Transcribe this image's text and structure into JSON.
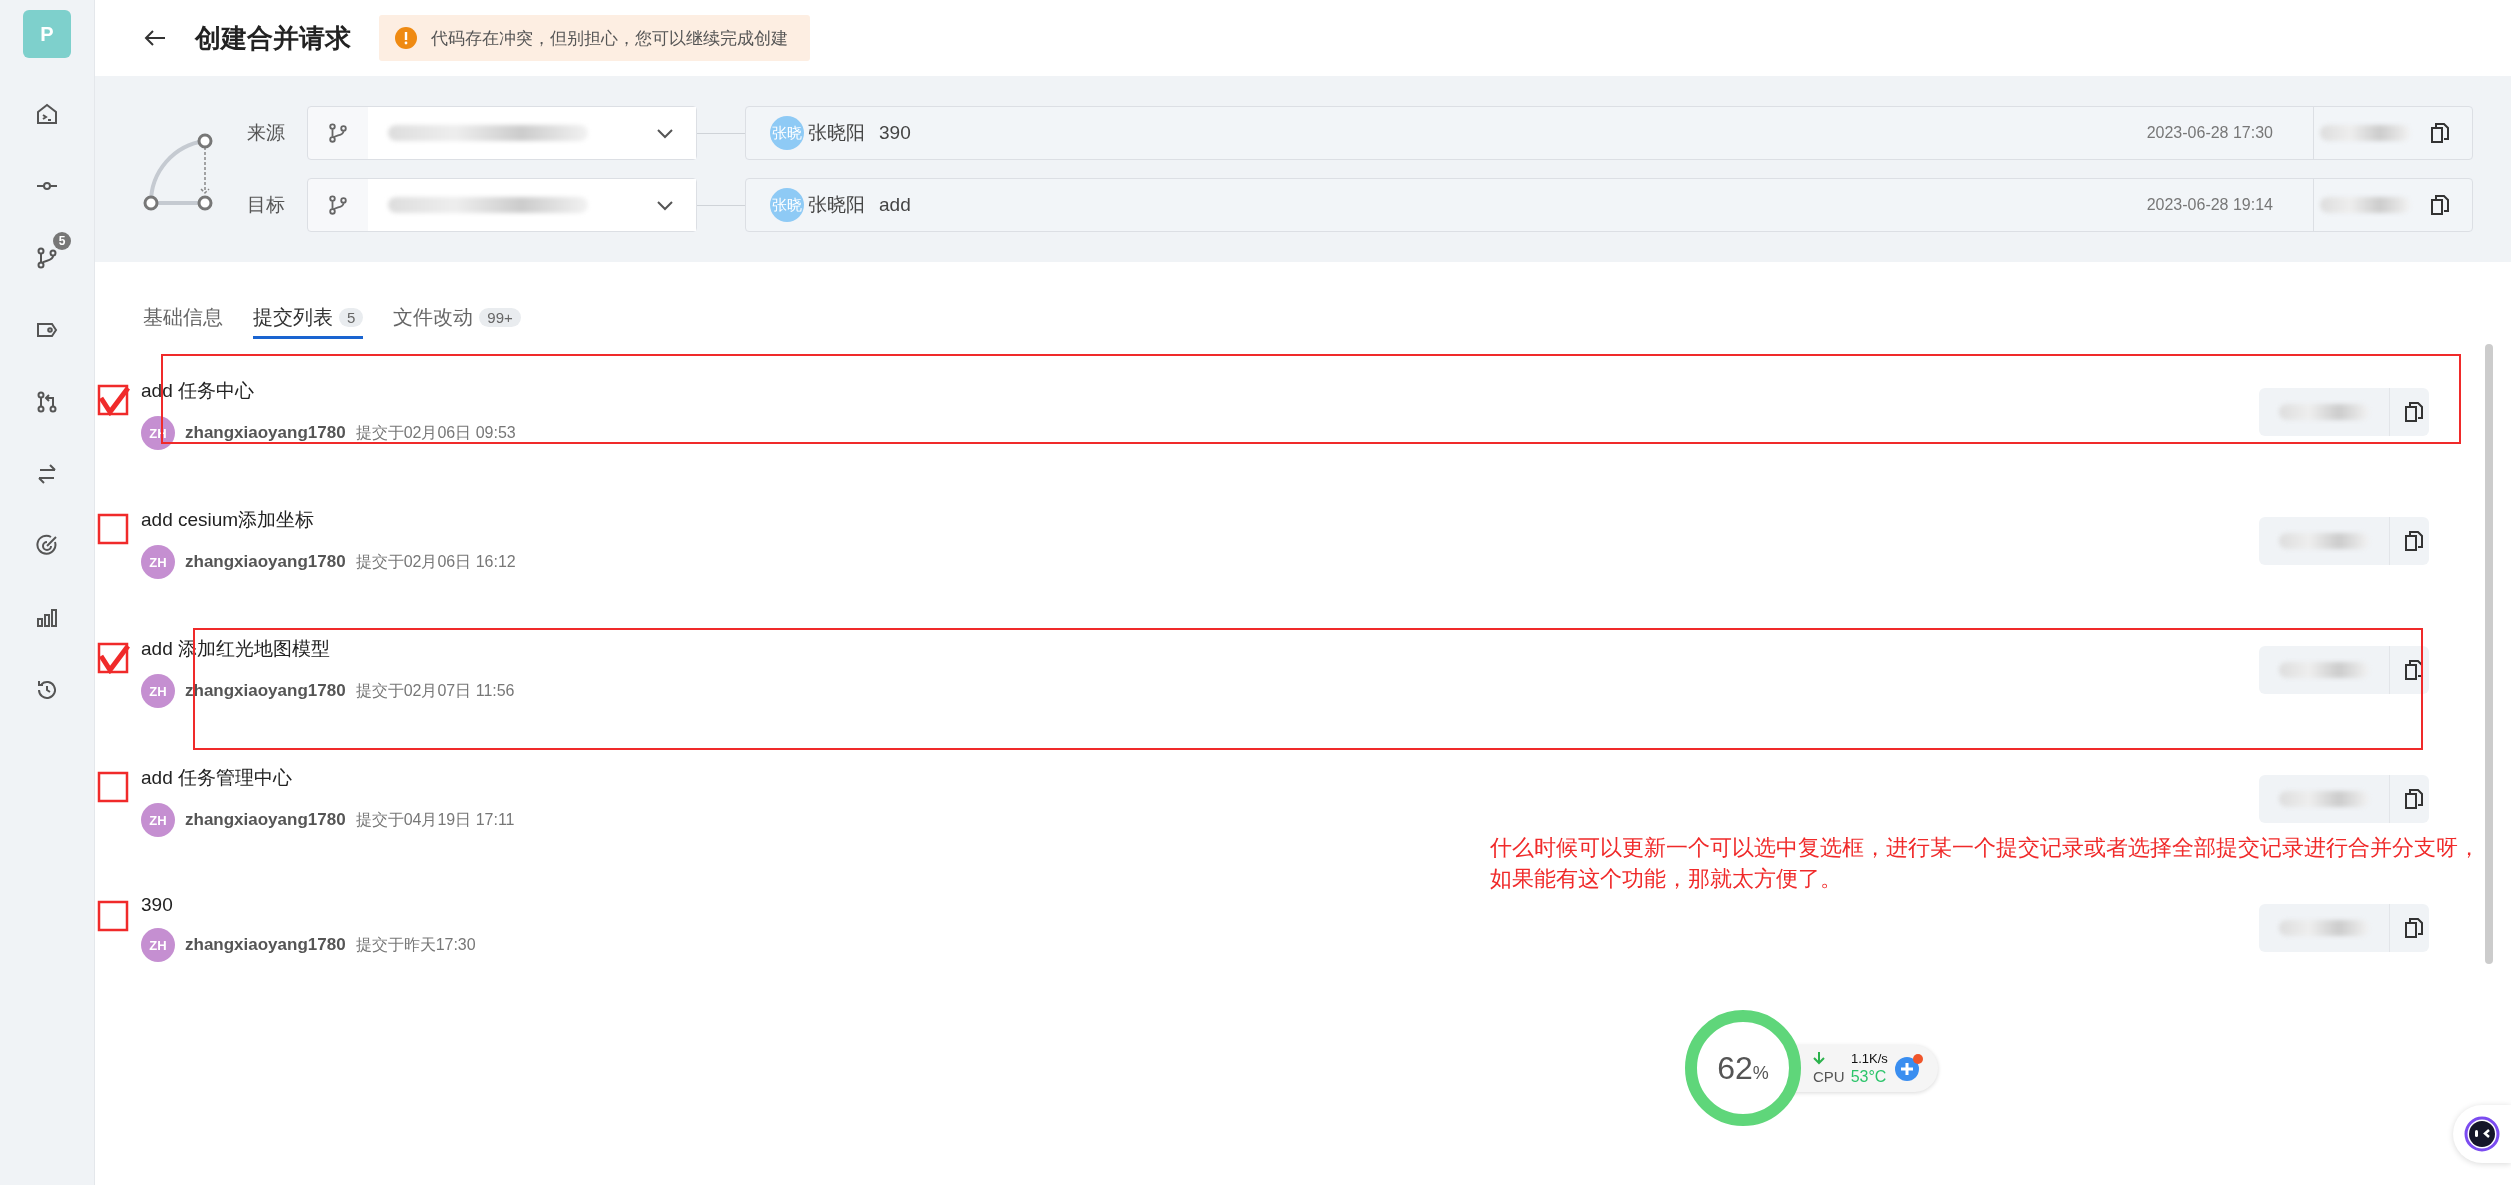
{
  "sidebar": {
    "project_initial": "P",
    "items": [
      {
        "kind": "terminal"
      },
      {
        "kind": "commit"
      },
      {
        "kind": "branch",
        "badge": "5"
      },
      {
        "kind": "tag"
      },
      {
        "kind": "merge"
      },
      {
        "kind": "compare"
      },
      {
        "kind": "target"
      },
      {
        "kind": "chart"
      },
      {
        "kind": "history"
      }
    ]
  },
  "header": {
    "title": "创建合并请求",
    "alert": "代码存在冲突，但别担心，您可以继续完成创建"
  },
  "branches": [
    {
      "label": "来源",
      "avatar": "张晓",
      "author": "张晓阳",
      "message": "390",
      "time": "2023-06-28 17:30"
    },
    {
      "label": "目标",
      "avatar": "张晓",
      "author": "张晓阳",
      "message": "add",
      "time": "2023-06-28 19:14"
    }
  ],
  "tabs": [
    {
      "label": "基础信息",
      "selected": false
    },
    {
      "label": "提交列表",
      "count": "5",
      "selected": true
    },
    {
      "label": "文件改动",
      "count": "99+",
      "selected": false
    }
  ],
  "commits": [
    {
      "title": "add 任务中心",
      "avatar": "ZH",
      "author": "zhangxiaoyang1780",
      "time": "提交于02月06日 09:53",
      "checked": true,
      "highlighted": true
    },
    {
      "title": "add cesium添加坐标",
      "avatar": "ZH",
      "author": "zhangxiaoyang1780",
      "time": "提交于02月06日 16:12",
      "checked": false,
      "highlighted": false
    },
    {
      "title": "add 添加红光地图模型",
      "avatar": "ZH",
      "author": "zhangxiaoyang1780",
      "time": "提交于02月07日 11:56",
      "checked": true,
      "highlighted": true
    },
    {
      "title": "add 任务管理中心",
      "avatar": "ZH",
      "author": "zhangxiaoyang1780",
      "time": "提交于04月19日 17:11",
      "checked": false,
      "highlighted": false
    },
    {
      "title": "390",
      "avatar": "ZH",
      "author": "zhangxiaoyang1780",
      "time": "提交于昨天17:30",
      "checked": false,
      "highlighted": false
    }
  ],
  "annotation": "什么时候可以更新一个可以选中复选框，进行某一个提交记录或者选择全部提交记录进行合并分支呀，如果能有这个功能，那就太方便了。",
  "monitor": {
    "percent": "62",
    "unit": "%",
    "speed": "1.1K/s",
    "cpu_label": "CPU",
    "temperature": "53°C"
  }
}
